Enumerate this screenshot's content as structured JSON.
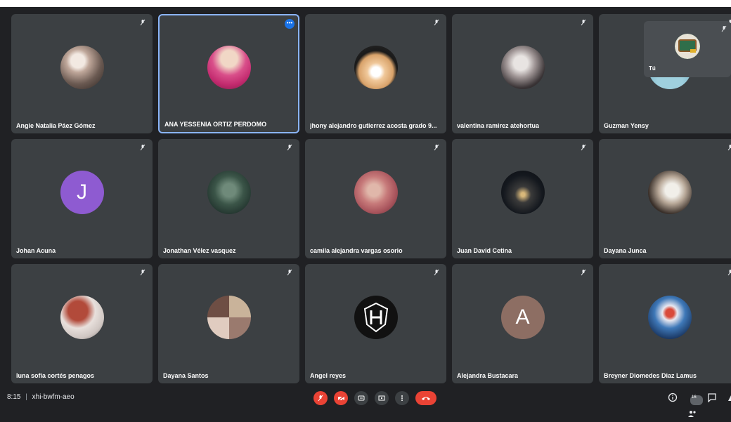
{
  "meeting": {
    "time": "8:15",
    "separator": "|",
    "code": "xhi-bwfm-aeo",
    "participant_count": "16"
  },
  "self_view": {
    "name": "Tú"
  },
  "participants": [
    {
      "name": "Angie Natalia Páez Gómez",
      "avatar_type": "photo",
      "avatar_color": "#6b5a52"
    },
    {
      "name": "ANA YESSENIA ORTIZ PERDOMO",
      "avatar_type": "photo",
      "avatar_color": "#c22a6e",
      "active": true
    },
    {
      "name": "jhony alejandro gutierrez acosta grado 9...",
      "avatar_type": "photo",
      "avatar_color": "#d8a26a"
    },
    {
      "name": "valentina ramirez atehortua",
      "avatar_type": "photo",
      "avatar_color": "#3a3436"
    },
    {
      "name": "Guzman Yensy",
      "avatar_type": "photo",
      "avatar_color": "#7fb7c9"
    },
    {
      "name": "Johan Acuna",
      "avatar_type": "letter",
      "letter": "J",
      "avatar_color": "#8e5bd1"
    },
    {
      "name": "Jonathan Vélez vasquez",
      "avatar_type": "photo",
      "avatar_color": "#3b5548"
    },
    {
      "name": "camila alejandra vargas osorio",
      "avatar_type": "photo",
      "avatar_color": "#a8545c"
    },
    {
      "name": "Juan David Cetina",
      "avatar_type": "photo",
      "avatar_color": "#14181e"
    },
    {
      "name": "Dayana Junca",
      "avatar_type": "photo",
      "avatar_color": "#8a7a6a"
    },
    {
      "name": "luna sofia cortés penagos",
      "avatar_type": "photo",
      "avatar_color": "#b24a3a"
    },
    {
      "name": "Dayana Santos",
      "avatar_type": "photo",
      "avatar_color": "#9a7a6e"
    },
    {
      "name": "Angel reyes",
      "avatar_type": "photo",
      "avatar_color": "#111111"
    },
    {
      "name": "Alejandra Bustacara",
      "avatar_type": "letter",
      "letter": "A",
      "avatar_color": "#8d6e63"
    },
    {
      "name": "Breyner Diomedes Diaz Lamus",
      "avatar_type": "photo",
      "avatar_color": "#3e78b8"
    }
  ],
  "colors": {
    "background": "#202124",
    "tile": "#3c4043",
    "active_border": "#8ab4f8",
    "hangup": "#ea4335"
  },
  "icons": {
    "tile_mic": "mic-off-icon",
    "controls": [
      "mic-off-icon",
      "camera-off-icon",
      "captions-icon",
      "present-icon",
      "more-options-icon",
      "hangup-icon"
    ],
    "right": [
      "info-icon",
      "people-icon",
      "chat-icon",
      "activities-icon"
    ]
  }
}
